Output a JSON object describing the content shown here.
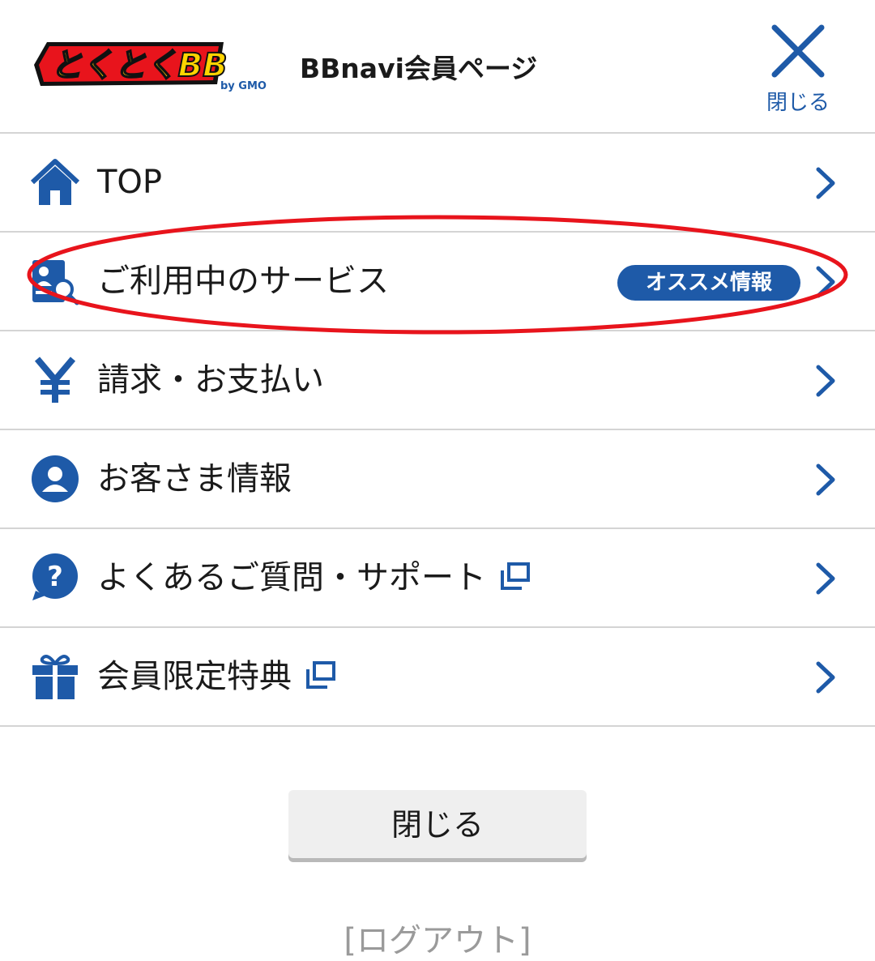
{
  "header": {
    "logo_text": "とくとくBB",
    "logo_sub": "by GMO",
    "title": "BBnavi会員ページ",
    "close_label": "閉じる"
  },
  "menu": {
    "items": [
      {
        "label": "TOP",
        "icon": "home-icon"
      },
      {
        "label": "ご利用中のサービス",
        "icon": "service-search-icon",
        "badge": "オススメ情報"
      },
      {
        "label": "請求・お支払い",
        "icon": "yen-icon"
      },
      {
        "label": "お客さま情報",
        "icon": "user-icon"
      },
      {
        "label": "よくあるご質問・サポート",
        "icon": "question-icon",
        "external": true
      },
      {
        "label": "会員限定特典",
        "icon": "gift-icon",
        "external": true
      }
    ]
  },
  "footer": {
    "close_button": "閉じる",
    "logout": "[ログアウト]"
  },
  "colors": {
    "accent": "#1e5aa8",
    "highlight": "#e8141c",
    "logo_yellow": "#ffd400",
    "logo_red": "#e8141c"
  }
}
